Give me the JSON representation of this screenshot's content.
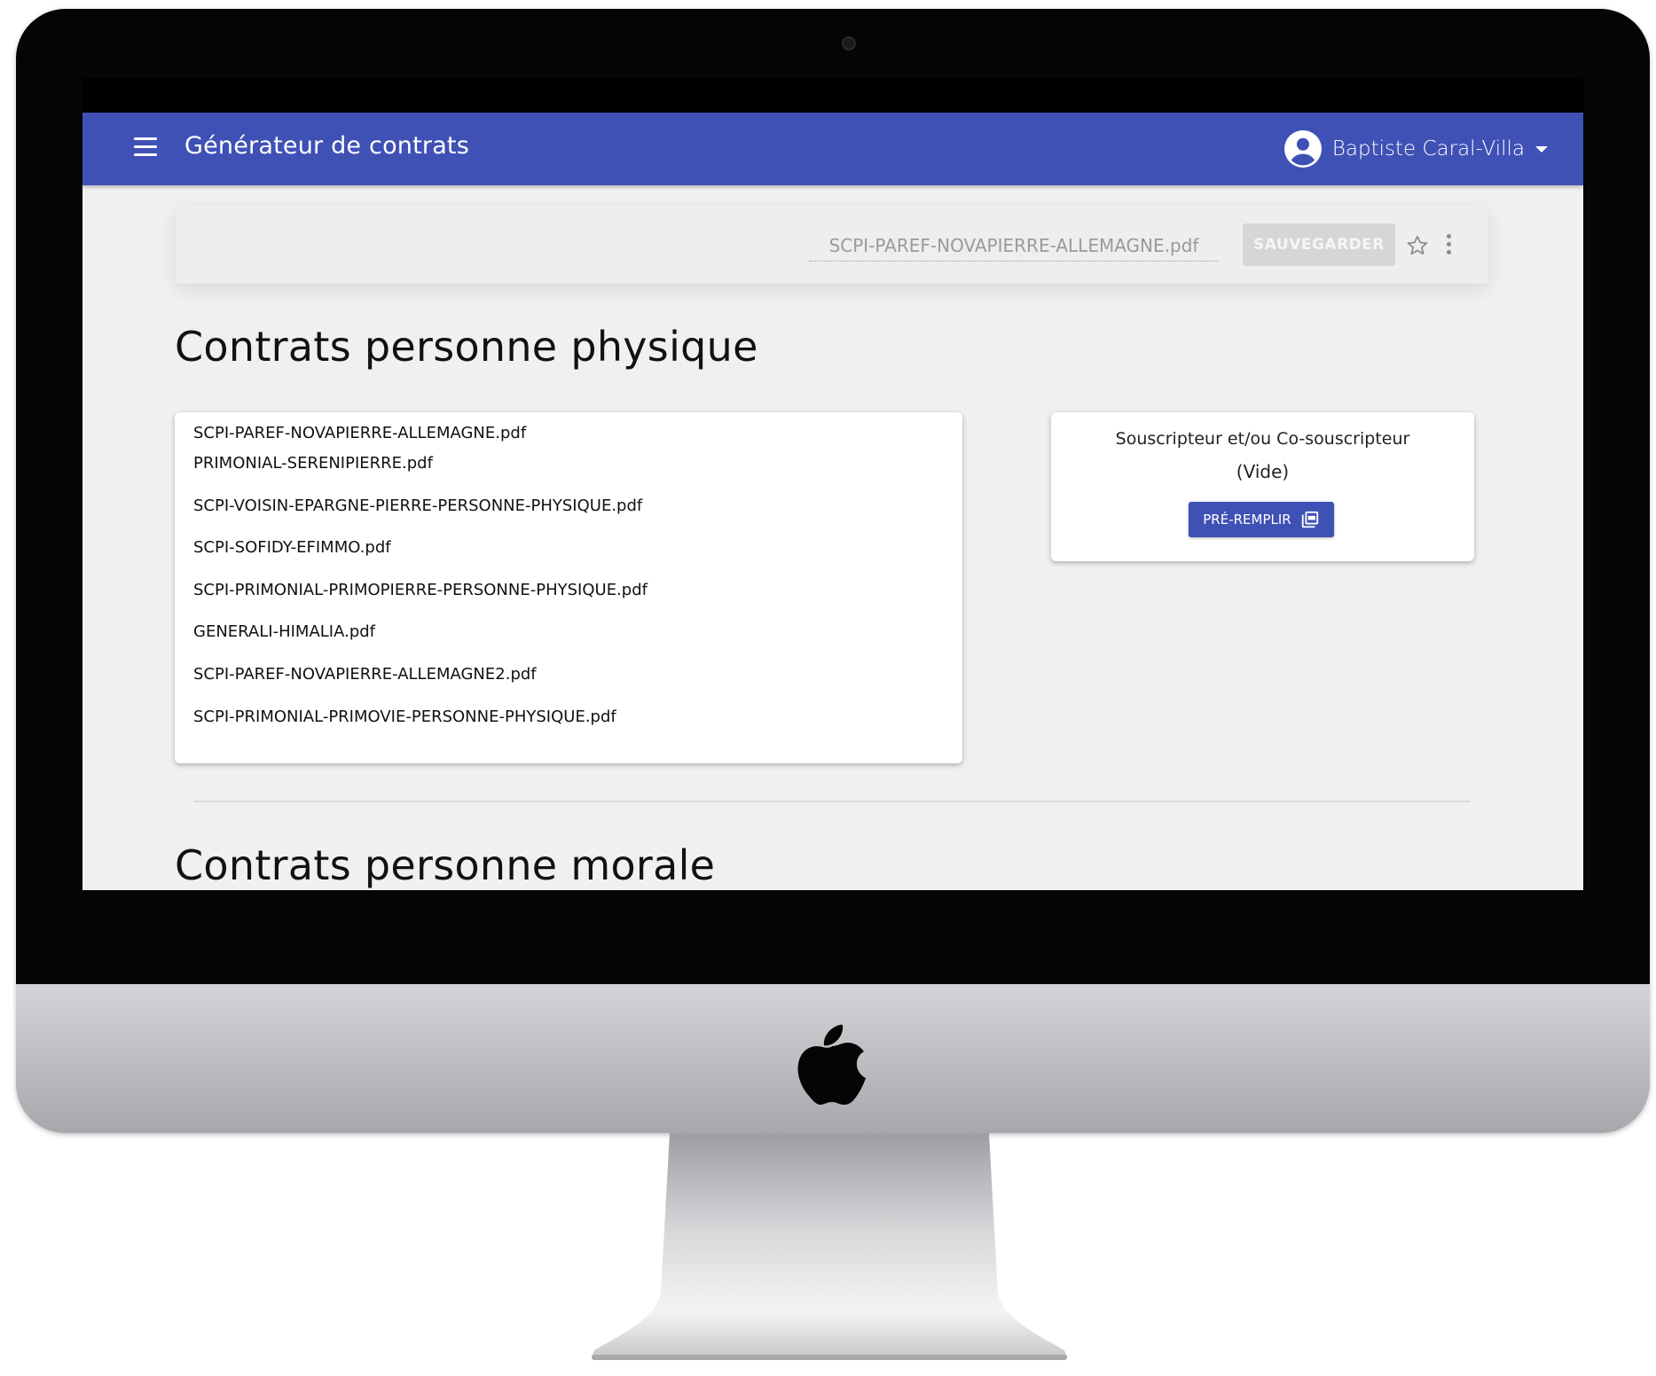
{
  "app": {
    "title": "Générateur de contrats",
    "user_name": "Baptiste Caral-Villa",
    "accent_color": "#3f51b5"
  },
  "toolbar": {
    "filename_value": "SCPI-PAREF-NOVAPIERRE-ALLEMAGNE.pdf",
    "save_label": "SAUVEGARDER"
  },
  "sections": {
    "physique_title": "Contrats personne physique",
    "morale_title": "Contrats personne morale"
  },
  "contracts": [
    "SCPI-PAREF-NOVAPIERRE-ALLEMAGNE.pdf",
    "PRIMONIAL-SERENIPIERRE.pdf",
    "SCPI-VOISIN-EPARGNE-PIERRE-PERSONNE-PHYSIQUE.pdf",
    "SCPI-SOFIDY-EFIMMO.pdf",
    "SCPI-PRIMONIAL-PRIMOPIERRE-PERSONNE-PHYSIQUE.pdf",
    "GENERALI-HIMALIA.pdf",
    "SCPI-PAREF-NOVAPIERRE-ALLEMAGNE2.pdf",
    "SCPI-PRIMONIAL-PRIMOVIE-PERSONNE-PHYSIQUE.pdf"
  ],
  "subscriber": {
    "title": "Souscripteur et/ou Co-souscripteur",
    "status": "(Vide)",
    "prefill_label": "PRÉ-REMPLIR"
  },
  "icons": {
    "menu": "menu-icon",
    "avatar": "account-circle-icon",
    "caret": "caret-down-icon",
    "star": "star-outline-icon",
    "more": "more-vert-icon",
    "pdf": "picture-as-pdf-icon"
  }
}
